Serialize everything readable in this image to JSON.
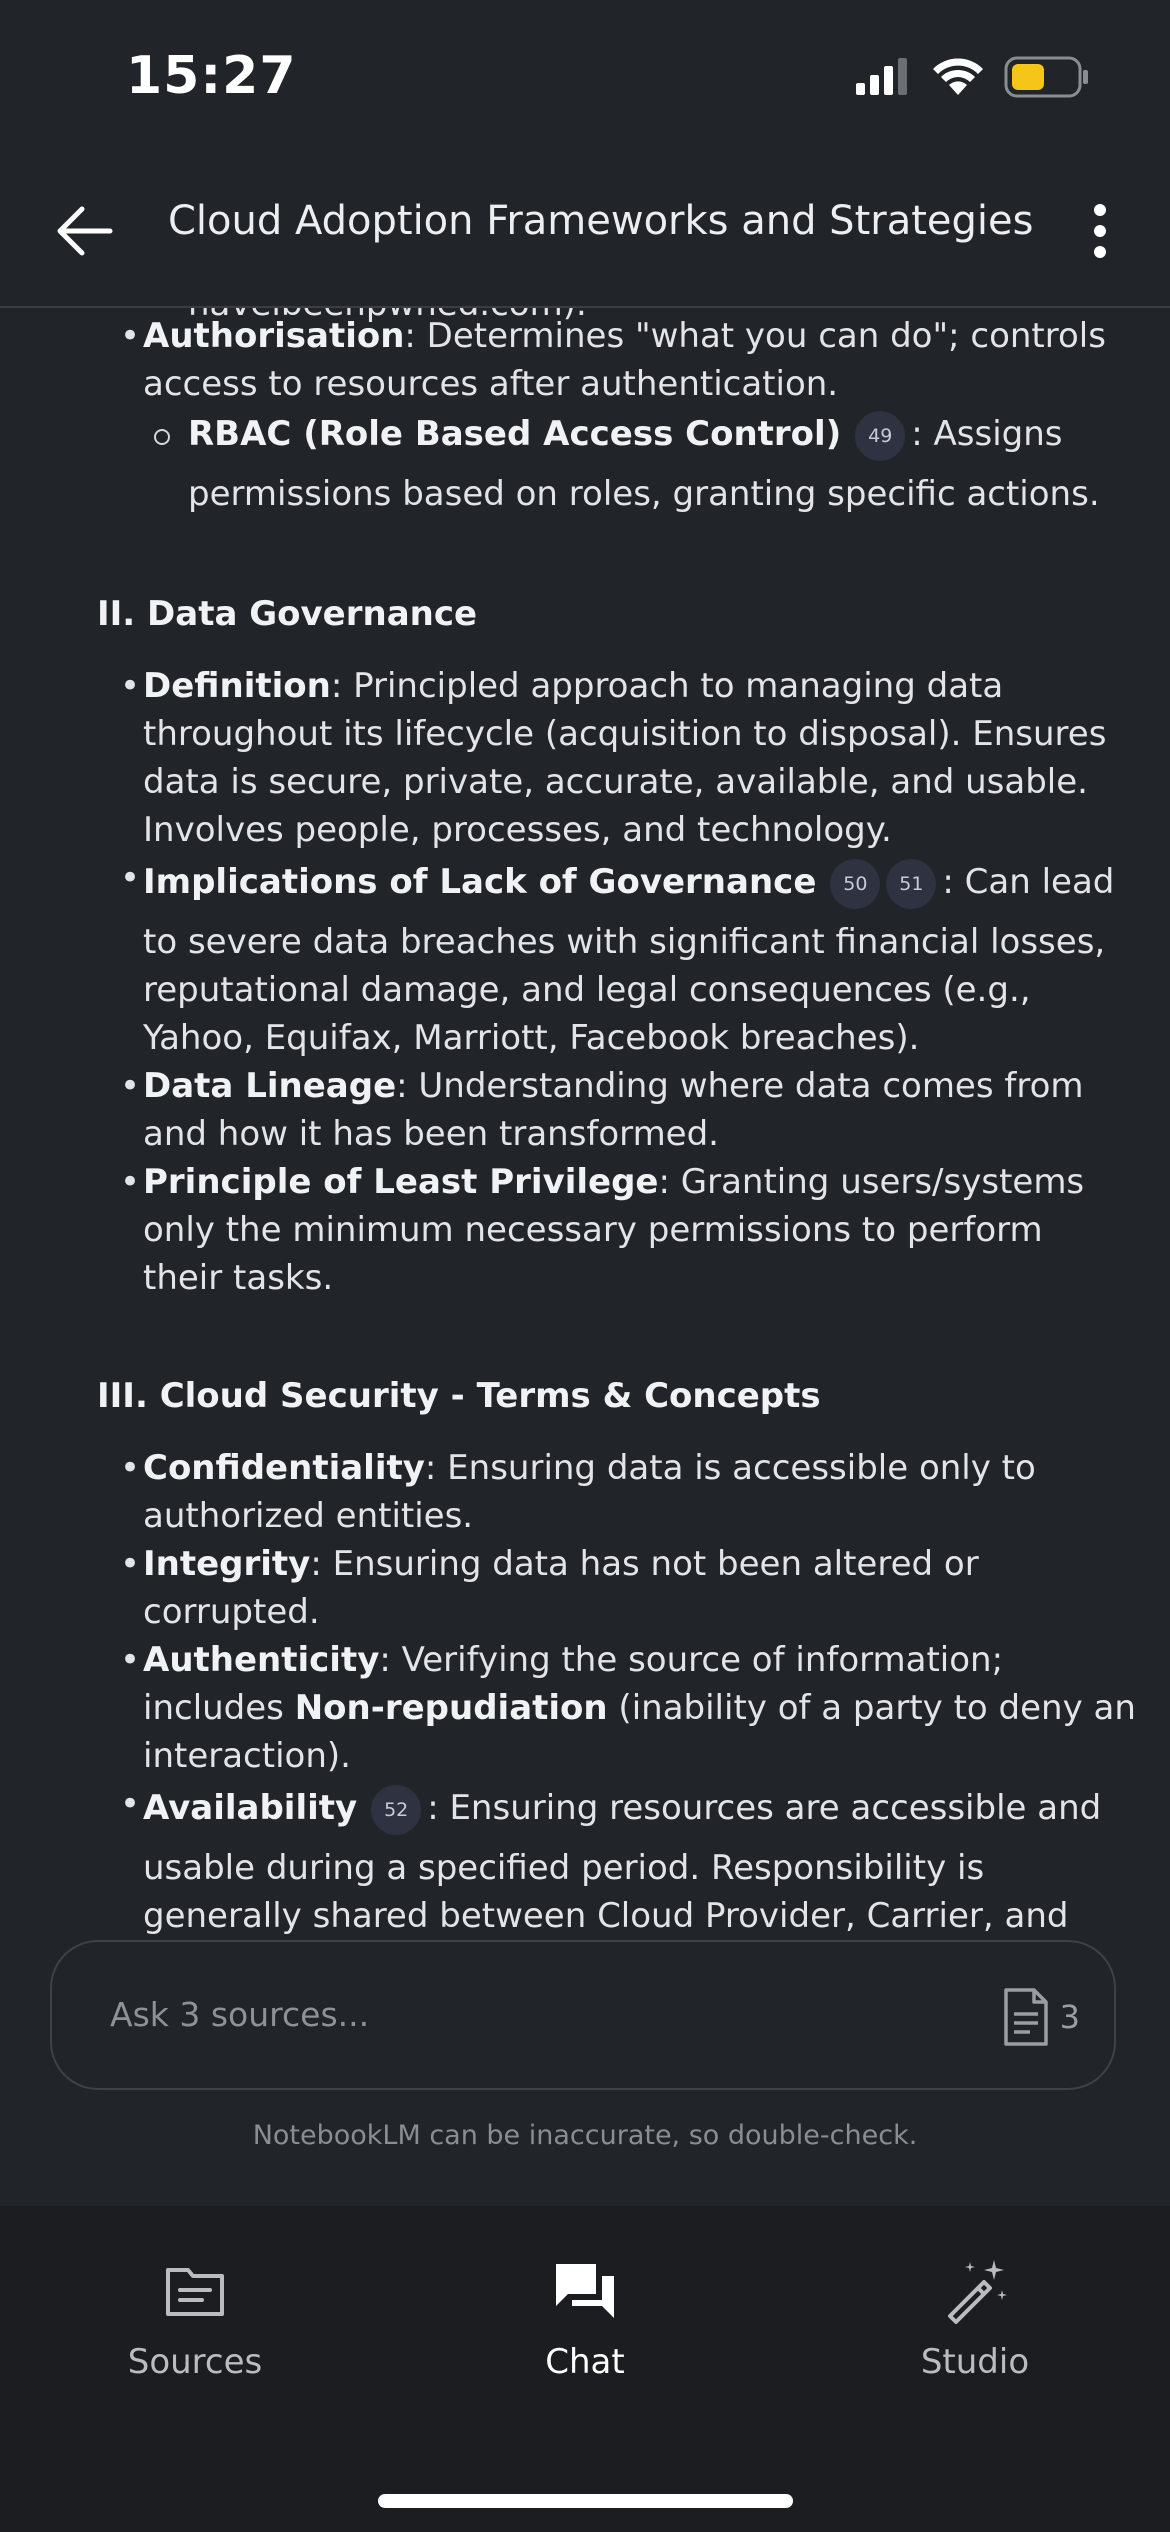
{
  "status_bar": {
    "time": "15:27"
  },
  "app_bar": {
    "title": "Cloud Adoption Frameworks and Strategies"
  },
  "content": {
    "partial_top_text": "haveibeenpwned.com).",
    "authorisation": {
      "term": "Authorisation",
      "line1_rest": ": Determines \"what you can do\"; controls",
      "line2": "access to resources after authentication."
    },
    "rbac": {
      "term": "RBAC (Role Based Access Control)",
      "citation": "49",
      "line1_rest": ": Assigns",
      "line2": "permissions based on roles, granting specific actions."
    },
    "section2": {
      "heading": "II. Data Governance",
      "definition": {
        "term": "Definition",
        "line1_rest": ": Principled approach to managing data",
        "line2": "throughout its lifecycle (acquisition to disposal). Ensures",
        "line3": "data is secure, private, accurate, available, and usable.",
        "line4": "Involves people, processes, and technology."
      },
      "implications": {
        "term": "Implications of Lack of Governance",
        "citation_a": "50",
        "citation_b": "51",
        "line1_rest": ": Can lead",
        "line2": "to severe data breaches with significant financial losses,",
        "line3": "reputational damage, and legal consequences (e.g.,",
        "line4": "Yahoo, Equifax, Marriott, Facebook breaches)."
      },
      "lineage": {
        "term": "Data Lineage",
        "line1_rest": ": Understanding where data comes from",
        "line2": "and how it has been transformed."
      },
      "least_privilege": {
        "term": "Principle of Least Privilege",
        "line1_rest": ": Granting users/systems",
        "line2": "only the minimum necessary permissions to perform",
        "line3": "their tasks."
      }
    },
    "section3": {
      "heading": "III. Cloud Security - Terms & Concepts",
      "confidentiality": {
        "term": "Confidentiality",
        "line1_rest": ": Ensuring data is accessible only to",
        "line2": "authorized entities."
      },
      "integrity": {
        "term": "Integrity",
        "line1_rest": ": Ensuring data has not been altered or",
        "line2": "corrupted."
      },
      "authenticity": {
        "term": "Authenticity",
        "line1_rest": ": Verifying the source of information;",
        "line2_pre": "includes ",
        "line2_term": "Non-repudiation",
        "line2_rest": " (inability of a party to deny an",
        "line3": "interaction)."
      },
      "availability": {
        "term": "Availability",
        "citation": "52",
        "line1_rest": ": Ensuring resources are accessible and",
        "line2": "usable during a specified period. Responsibility is",
        "line3": "generally shared between Cloud Provider, Carrier, and"
      }
    }
  },
  "input": {
    "placeholder": "Ask 3 sources...",
    "source_count": "3",
    "disclaimer": "NotebookLM can be inaccurate, so double-check."
  },
  "bottom_nav": {
    "items": [
      {
        "label": "Sources",
        "icon": "sources-icon"
      },
      {
        "label": "Chat",
        "icon": "chat-icon",
        "active": true
      },
      {
        "label": "Studio",
        "icon": "studio-icon"
      }
    ]
  },
  "colors": {
    "background": "#212428",
    "nav_background": "#1b1d20",
    "citation_chip": "#2f3240",
    "battery": "#f5c518"
  }
}
